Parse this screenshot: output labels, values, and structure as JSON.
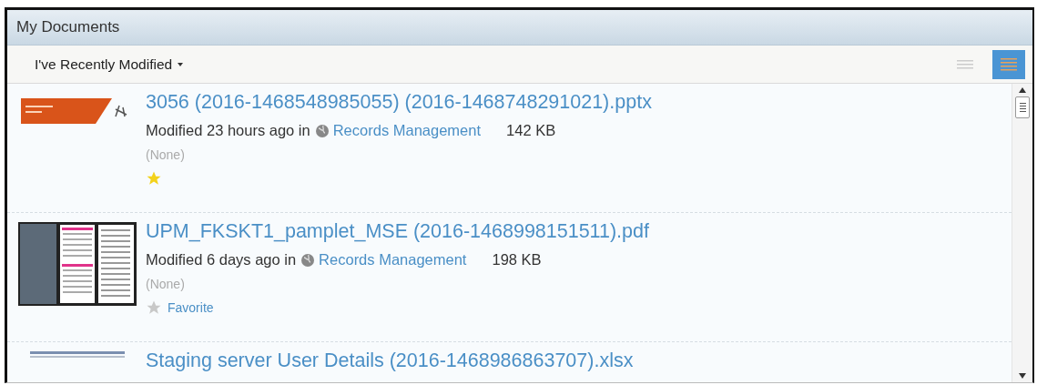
{
  "panel": {
    "title": "My Documents"
  },
  "toolbar": {
    "filter": "I've Recently Modified",
    "views": [
      {
        "kind": "simple",
        "selected": false
      },
      {
        "kind": "detailed",
        "selected": true
      }
    ]
  },
  "documents": [
    {
      "kind": "slide",
      "title": "3056 (2016-1468548985055) (2016-1468748291021).pptx",
      "modified": "Modified 23 hours ago in",
      "site": "Records Management",
      "size": "142 KB",
      "description": "(None)",
      "favorite": true
    },
    {
      "kind": "pdf",
      "title": "UPM_FKSKT1_pamplet_MSE (2016-1468998151511).pdf",
      "modified": "Modified 6 days ago in",
      "site": "Records Management",
      "size": "198 KB",
      "description": "(None)",
      "favorite": false,
      "favorite_label": "Favorite"
    },
    {
      "kind": "sheet",
      "title": "Staging server User  Details (2016-1468986863707).xlsx"
    }
  ]
}
